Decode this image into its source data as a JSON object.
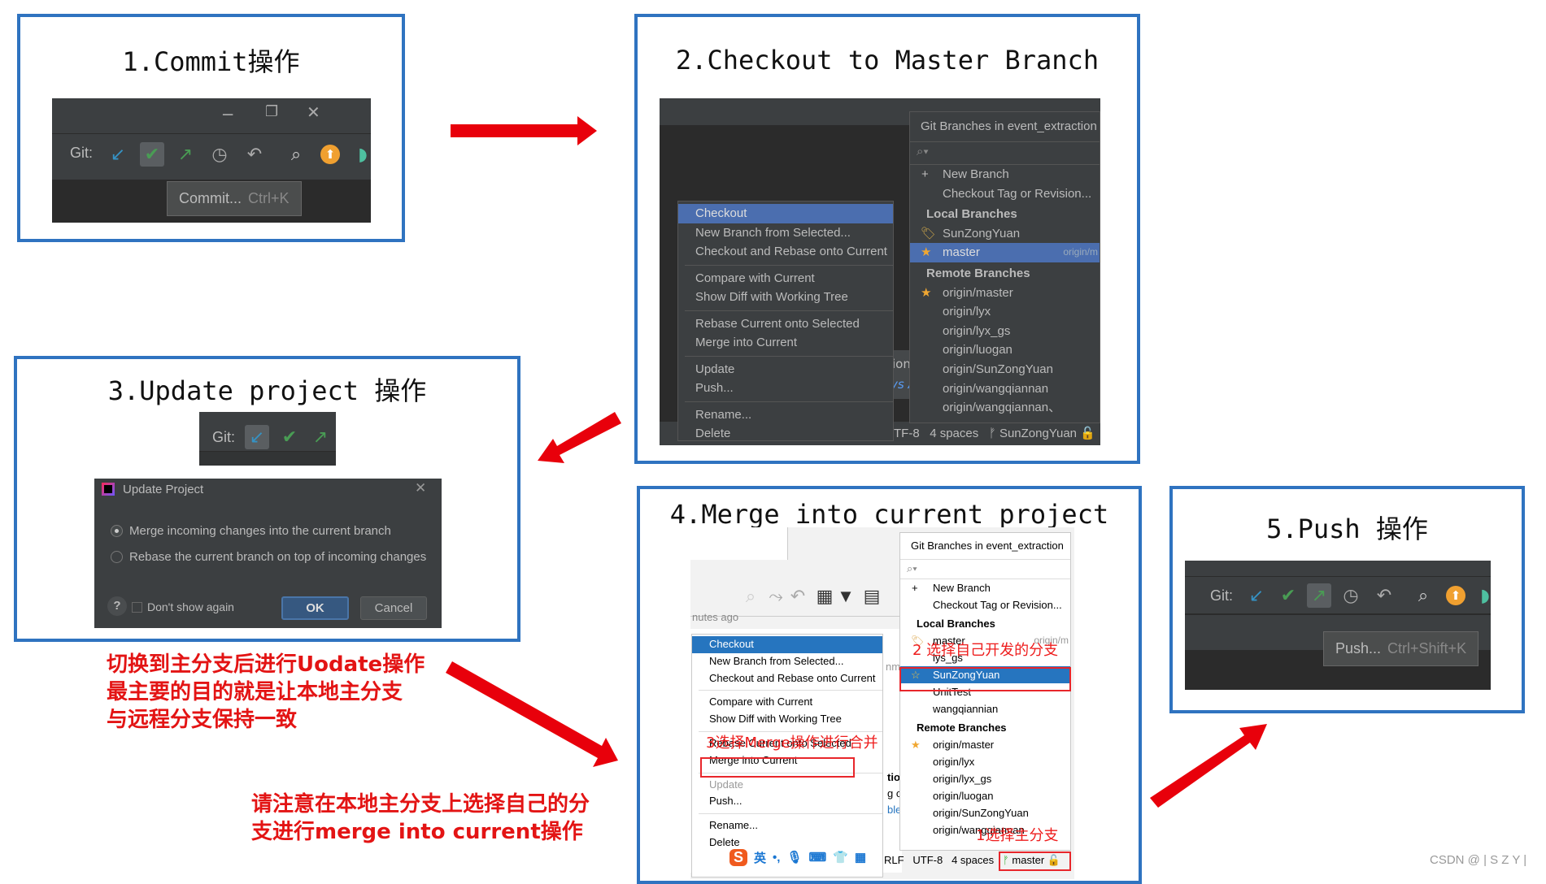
{
  "colors": {
    "panel_border": "#2f73c0",
    "arrow": "#e8000b",
    "annotation": "#e31414",
    "ide_dark": "#3c3f41",
    "highlight_dark": "#4b6eaf",
    "highlight_light": "#2675bf"
  },
  "step1": {
    "title": "1.Commit操作",
    "git_label": "Git:",
    "window_controls": [
      "minimize-icon",
      "restore-icon",
      "close-icon"
    ],
    "icons": [
      "update-arrow-icon",
      "commit-check-icon",
      "push-arrow-icon",
      "history-clock-icon",
      "rollback-icon",
      "search-icon",
      "upload-circle-icon",
      "plugin-icon"
    ],
    "tooltip": {
      "label": "Commit...",
      "shortcut": "Ctrl+K"
    }
  },
  "step2": {
    "title": "2.Checkout to Master Branch",
    "context_menu": [
      [
        "Checkout",
        "New Branch from Selected...",
        "Checkout and Rebase onto Current"
      ],
      [
        "Compare with Current",
        "Show Diff with Working Tree"
      ],
      [
        "Rebase Current onto Selected",
        "Merge into Current"
      ],
      [
        "Update",
        "Push..."
      ],
      [
        "Rename...",
        "Delete"
      ]
    ],
    "popup": {
      "header": "Git Branches in event_extraction",
      "actions": [
        "New Branch",
        "Checkout Tag or Revision..."
      ],
      "local_header": "Local Branches",
      "local": [
        "SunZongYuan",
        "master"
      ],
      "master_tracking": "origin/m",
      "remote_header": "Remote Branches",
      "remote": [
        "origin/master",
        "origin/lyx",
        "origin/lyx_gs",
        "origin/luogan",
        "origin/SunZongYuan",
        "origin/wangqiannan",
        "origin/wangqiannan、"
      ]
    },
    "status": {
      "encoding": "TF-8",
      "indent": "4 spaces",
      "branch": "SunZongYuan"
    },
    "bg_fragments": [
      "ion",
      "ys A"
    ]
  },
  "step3": {
    "title": "3.Update project 操作",
    "git_label": "Git:",
    "icons": [
      "update-arrow-icon",
      "commit-check-icon",
      "push-arrow-icon"
    ],
    "dialog": {
      "title": "Update Project",
      "options": [
        {
          "label": "Merge incoming changes into the current branch",
          "selected": true
        },
        {
          "label": "Rebase the current branch on top of incoming changes",
          "selected": false
        }
      ],
      "dont_show": "Don't show again",
      "dont_show_checked": false,
      "ok": "OK",
      "cancel": "Cancel",
      "help": "?"
    }
  },
  "note1": [
    "切换到主分支后进行Uodate操作",
    "最主要的目的就是让本地主分支",
    "与远程分支保持一致"
  ],
  "note2": [
    "请注意在本地主分支上选择自己的分",
    "支进行merge into current操作"
  ],
  "step4": {
    "title": "4.Merge into current project",
    "time_fragment": "nutes ago",
    "toolbar_icons": [
      "search-icon",
      "cherry-pick-icon",
      "undo-icon",
      "group-icon",
      "filter-icon",
      "layout-icon"
    ],
    "context_menu": [
      [
        "Checkout",
        "New Branch from Selected...",
        "Checkout and Rebase onto Current"
      ],
      [
        "Compare with Current",
        "Show Diff with Working Tree"
      ],
      [
        "Rebase Current onto Selected",
        "Merge into Current"
      ],
      [
        "Update",
        "Push..."
      ],
      [
        "Rename...",
        "Delete"
      ]
    ],
    "popup": {
      "header": "Git Branches in event_extraction",
      "actions": [
        "New Branch",
        "Checkout Tag or Revision..."
      ],
      "local_header": "Local Branches",
      "local": [
        "master",
        "lys_gs",
        "SunZongYuan",
        "UnitTest",
        "wangqiannian"
      ],
      "master_tracking": "origin/m",
      "remote_header": "Remote Branches",
      "remote": [
        "origin/master",
        "origin/lyx",
        "origin/lyx_gs",
        "origin/luogan",
        "origin/SunZongYuan",
        "origin/wangqiannan"
      ]
    },
    "status": {
      "line_sep": "RLF",
      "encoding": "UTF-8",
      "indent": "4 spaces",
      "branch": "master"
    },
    "ime": {
      "lang": "英",
      "punct": "•,"
    },
    "bg_fragments": [
      "nmi",
      "tio",
      "g cc",
      "ble"
    ],
    "annotations": {
      "a1": "1选择主分支",
      "a2": "2 选择自己开发的分支",
      "a3": "3选择Merge操作进行合并"
    }
  },
  "step5": {
    "title": "5.Push 操作",
    "git_label": "Git:",
    "icons": [
      "update-arrow-icon",
      "commit-check-icon",
      "push-arrow-icon",
      "history-clock-icon",
      "rollback-icon",
      "search-icon",
      "upload-circle-icon",
      "plugin-icon"
    ],
    "tooltip": {
      "label": "Push...",
      "shortcut": "Ctrl+Shift+K"
    }
  },
  "watermark": "CSDN @ | S Z Y |"
}
